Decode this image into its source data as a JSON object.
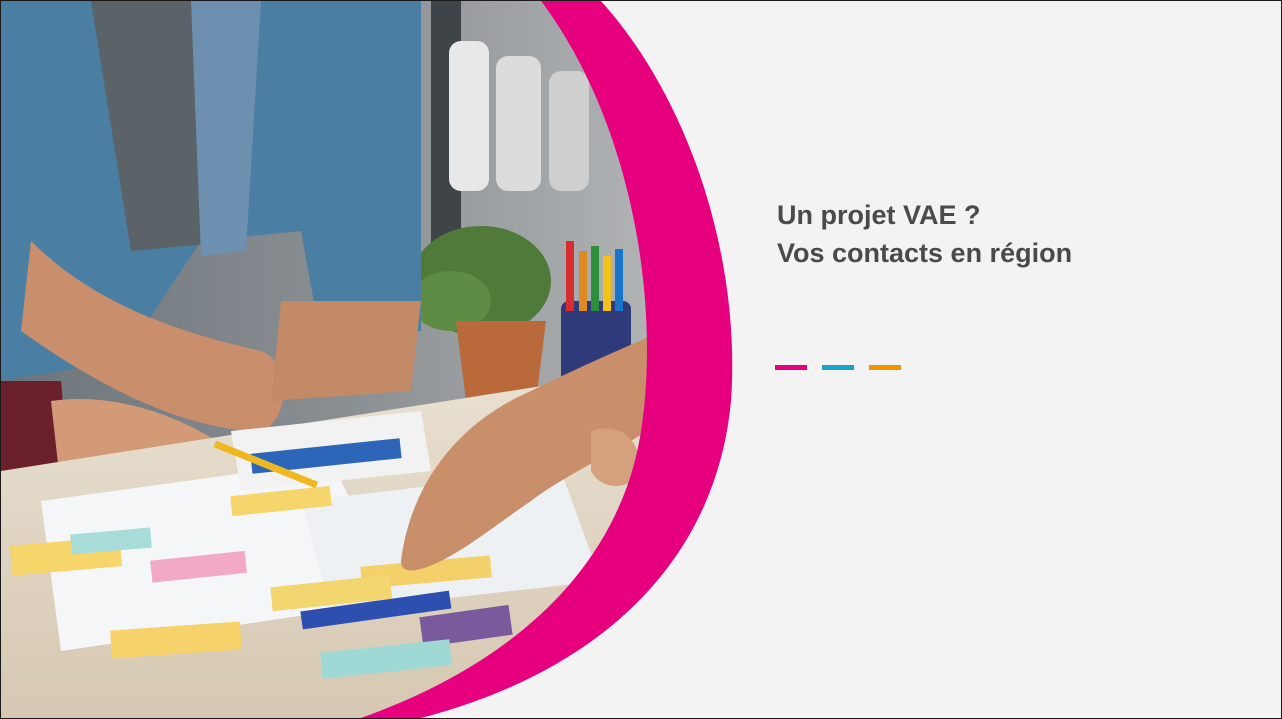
{
  "title": {
    "line1": "Un projet VAE ?",
    "line2": "Vos contacts en région"
  },
  "colors": {
    "accent_pink": "#e6007e",
    "accent_blue": "#1aa3c4",
    "accent_orange": "#f39200",
    "title_text": "#4a4a4a",
    "background": "#f3f3f3"
  },
  "photo": {
    "icon": "team-planning-photo"
  }
}
